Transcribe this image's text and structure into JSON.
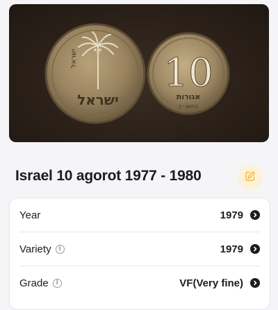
{
  "header": {
    "title": "Israel 10 agorot 1977 - 1980",
    "edit_icon": "edit-icon",
    "accent": "#f2b632"
  },
  "photo": {
    "coin_value": "10",
    "coin_word": "אגורות",
    "coin_year_heb": "התשנ״ב",
    "coin_country_heb": "ישראל"
  },
  "details": {
    "rows": [
      {
        "label": "Year",
        "value": "1979",
        "info": false
      },
      {
        "label": "Variety",
        "value": "1979",
        "info": true
      },
      {
        "label": "Grade",
        "value": "VF(Very fine)",
        "info": true
      }
    ]
  }
}
